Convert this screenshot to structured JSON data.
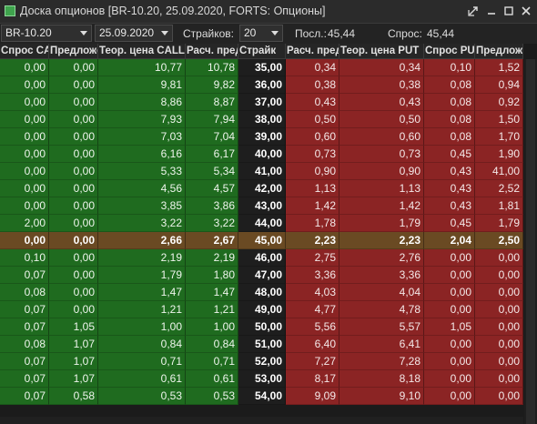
{
  "window": {
    "title": "Доска опционов [BR-10.20, 25.09.2020, FORTS: Опционы]"
  },
  "toolbar": {
    "instrument": "BR-10.20",
    "expiry": "25.09.2020",
    "strikes_label": "Страйков:",
    "strikes_value": "20",
    "last_label": "Посл.:",
    "last_value": "45,44",
    "bid_label": "Спрос:",
    "bid_value": "45,44"
  },
  "columns": [
    "Спрос CALL",
    "Предложение CALL",
    "Теор. цена CALL",
    "Расч. пред. CALL",
    "Страйк",
    "Расч. пред. PUT",
    "Теор. цена PUT",
    "Спрос PUT",
    "Предложение PUT"
  ],
  "rows": [
    [
      "0,00",
      "0,00",
      "10,77",
      "10,78",
      "35,00",
      "0,34",
      "0,34",
      "0,10",
      "1,52"
    ],
    [
      "0,00",
      "0,00",
      "9,81",
      "9,82",
      "36,00",
      "0,38",
      "0,38",
      "0,08",
      "0,94"
    ],
    [
      "0,00",
      "0,00",
      "8,86",
      "8,87",
      "37,00",
      "0,43",
      "0,43",
      "0,08",
      "0,92"
    ],
    [
      "0,00",
      "0,00",
      "7,93",
      "7,94",
      "38,00",
      "0,50",
      "0,50",
      "0,08",
      "1,50"
    ],
    [
      "0,00",
      "0,00",
      "7,03",
      "7,04",
      "39,00",
      "0,60",
      "0,60",
      "0,08",
      "1,70"
    ],
    [
      "0,00",
      "0,00",
      "6,16",
      "6,17",
      "40,00",
      "0,73",
      "0,73",
      "0,45",
      "1,90"
    ],
    [
      "0,00",
      "0,00",
      "5,33",
      "5,34",
      "41,00",
      "0,90",
      "0,90",
      "0,43",
      "41,00"
    ],
    [
      "0,00",
      "0,00",
      "4,56",
      "4,57",
      "42,00",
      "1,13",
      "1,13",
      "0,43",
      "2,52"
    ],
    [
      "0,00",
      "0,00",
      "3,85",
      "3,86",
      "43,00",
      "1,42",
      "1,42",
      "0,43",
      "1,81"
    ],
    [
      "2,00",
      "0,00",
      "3,22",
      "3,22",
      "44,00",
      "1,78",
      "1,79",
      "0,45",
      "1,79"
    ],
    [
      "0,00",
      "0,00",
      "2,66",
      "2,67",
      "45,00",
      "2,23",
      "2,23",
      "2,04",
      "2,50"
    ],
    [
      "0,10",
      "0,00",
      "2,19",
      "2,19",
      "46,00",
      "2,75",
      "2,76",
      "0,00",
      "0,00"
    ],
    [
      "0,07",
      "0,00",
      "1,79",
      "1,80",
      "47,00",
      "3,36",
      "3,36",
      "0,00",
      "0,00"
    ],
    [
      "0,08",
      "0,00",
      "1,47",
      "1,47",
      "48,00",
      "4,03",
      "4,04",
      "0,00",
      "0,00"
    ],
    [
      "0,07",
      "0,00",
      "1,21",
      "1,21",
      "49,00",
      "4,77",
      "4,78",
      "0,00",
      "0,00"
    ],
    [
      "0,07",
      "1,05",
      "1,00",
      "1,00",
      "50,00",
      "5,56",
      "5,57",
      "1,05",
      "0,00"
    ],
    [
      "0,08",
      "1,07",
      "0,84",
      "0,84",
      "51,00",
      "6,40",
      "6,41",
      "0,00",
      "0,00"
    ],
    [
      "0,07",
      "1,07",
      "0,71",
      "0,71",
      "52,00",
      "7,27",
      "7,28",
      "0,00",
      "0,00"
    ],
    [
      "0,07",
      "1,07",
      "0,61",
      "0,61",
      "53,00",
      "8,17",
      "8,18",
      "0,00",
      "0,00"
    ],
    [
      "0,07",
      "0,58",
      "0,53",
      "0,53",
      "54,00",
      "9,09",
      "9,10",
      "0,00",
      "0,00"
    ]
  ],
  "atm_strike": "45,00",
  "colors": {
    "call_bg": "#1f6b1f",
    "put_bg": "#8b2424",
    "atm_bg": "#6a4a23",
    "strike_bg": "#1e1e1e"
  }
}
